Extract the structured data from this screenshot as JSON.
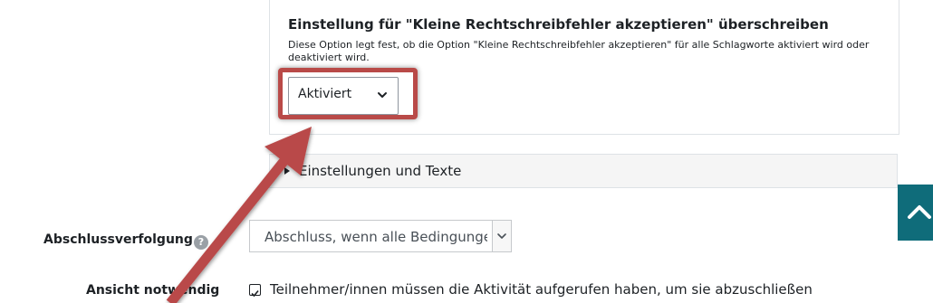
{
  "panel": {
    "title": "Einstellung für \"Kleine Rechtschreibfehler akzeptieren\" überschreiben",
    "description": "Diese Option legt fest, ob die Option \"Kleine Rechtschreibfehler akzeptieren\" für alle Schlagworte aktiviert wird oder deaktiviert wird.",
    "select_value": "Aktiviert"
  },
  "section": {
    "label": "Einstellungen und Texte"
  },
  "completion": {
    "label": "Abschlussverfolgung",
    "help_glyph": "?",
    "select_value": "Abschluss, wenn alle Bedingungen"
  },
  "view_required": {
    "label": "Ansicht notwendig",
    "checkbox_checked": true,
    "checkbox_text": "Teilnehmer/innen müssen die Aktivität aufgerufen haben, um sie abzuschließen"
  },
  "colors": {
    "highlight": "#b94a48",
    "arrow": "#b94a48",
    "back_to_top": "#0f6c7a"
  },
  "icons": {
    "select_caret": "chevron-down-icon",
    "section_toggle": "triangle-right-icon",
    "help": "question-circle-icon",
    "back_to_top": "chevron-up-icon"
  }
}
